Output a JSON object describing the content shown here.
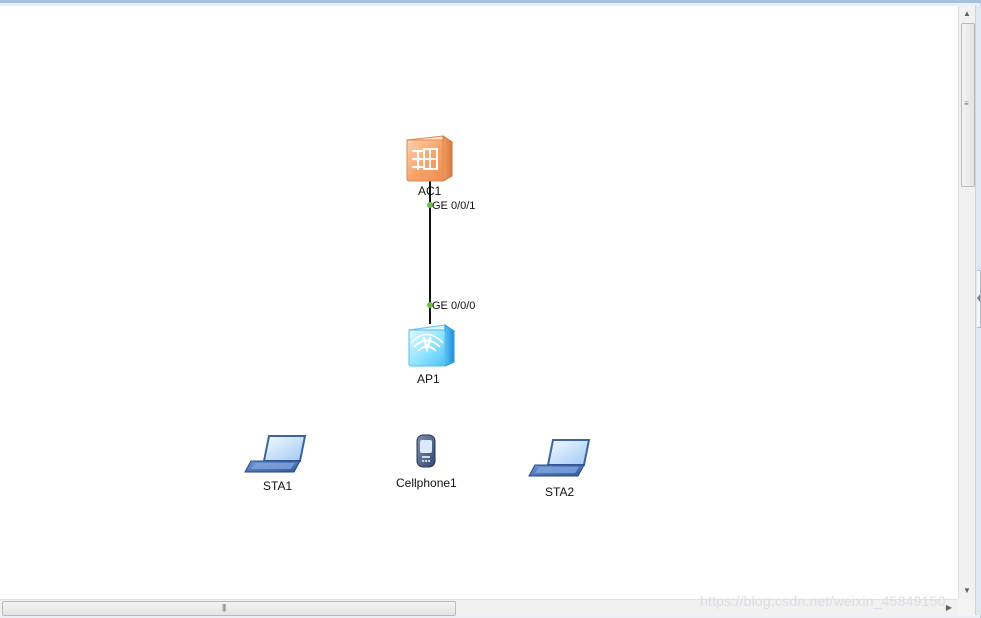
{
  "topology": {
    "devices": {
      "ac1": {
        "label": "AC1",
        "icon": "access-controller-icon"
      },
      "ap1": {
        "label": "AP1",
        "icon": "access-point-icon"
      },
      "sta1": {
        "label": "STA1",
        "icon": "laptop-icon"
      },
      "cellphone1": {
        "label": "Cellphone1",
        "icon": "cellphone-icon"
      },
      "sta2": {
        "label": "STA2",
        "icon": "laptop-icon"
      }
    },
    "links": [
      {
        "from": "AC1",
        "to": "AP1",
        "from_port": "GE 0/0/1",
        "to_port": "GE 0/0/0"
      }
    ]
  },
  "overlay": {
    "watermark": "https://blog.csdn.net/weixin_45849150"
  },
  "colors": {
    "canvas_background": "#ffffff",
    "ac_orange": "#f8a56c",
    "ap_blue": "#7fdcff",
    "laptop_blue": "#5378b8",
    "port_green": "#6bbd4b"
  }
}
